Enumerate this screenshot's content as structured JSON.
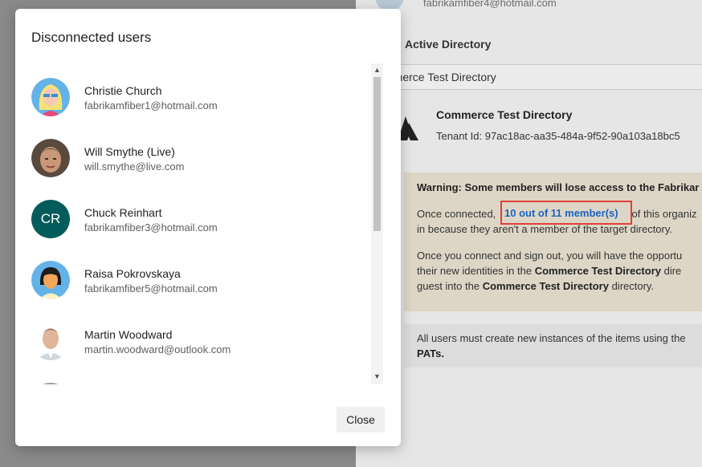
{
  "background": {
    "email": "fabrikamfiber4@hotmail.com",
    "aad_heading": "Active Directory",
    "directory_select": "mmerce Test Directory",
    "directory_name": "Commerce Test Directory",
    "tenant_id": "Tenant Id: 97ac18ac-aa35-484a-9f52-90a103a18bc5",
    "warning": {
      "title": "Warning: Some members will lose access to the Fabrikar",
      "line1_pre": "Once connected,",
      "line1_link": "10 out of 11 member(s)",
      "line1_post": "of this organiz",
      "line2": "in because they aren't a member of the target directory.",
      "line3": "Once you connect and sign out, you will have the opportu",
      "line4_pre": "their new identities in the",
      "line4_bold": "Commerce Test Directory",
      "line4_post": "dire",
      "line5_pre": "guest into the",
      "line5_bold": "Commerce Test Directory",
      "line5_post": "directory."
    },
    "info": {
      "line1": "All users must create new instances of the items using the",
      "line2": "PATs."
    }
  },
  "dialog": {
    "title": "Disconnected users",
    "close_label": "Close",
    "users": [
      {
        "name": "Christie Church",
        "email": "fabrikamfiber1@hotmail.com",
        "avatar": "illustrated-woman-blonde"
      },
      {
        "name": "Will Smythe (Live)",
        "email": "will.smythe@live.com",
        "avatar": "photo"
      },
      {
        "name": "Chuck Reinhart",
        "email": "fabrikamfiber3@hotmail.com",
        "avatar": "initials",
        "initials": "CR"
      },
      {
        "name": "Raisa Pokrovskaya",
        "email": "fabrikamfiber5@hotmail.com",
        "avatar": "illustrated-woman-dark-hair"
      },
      {
        "name": "Martin Woodward",
        "email": "martin.woodward@outlook.com",
        "avatar": "photo"
      }
    ]
  }
}
